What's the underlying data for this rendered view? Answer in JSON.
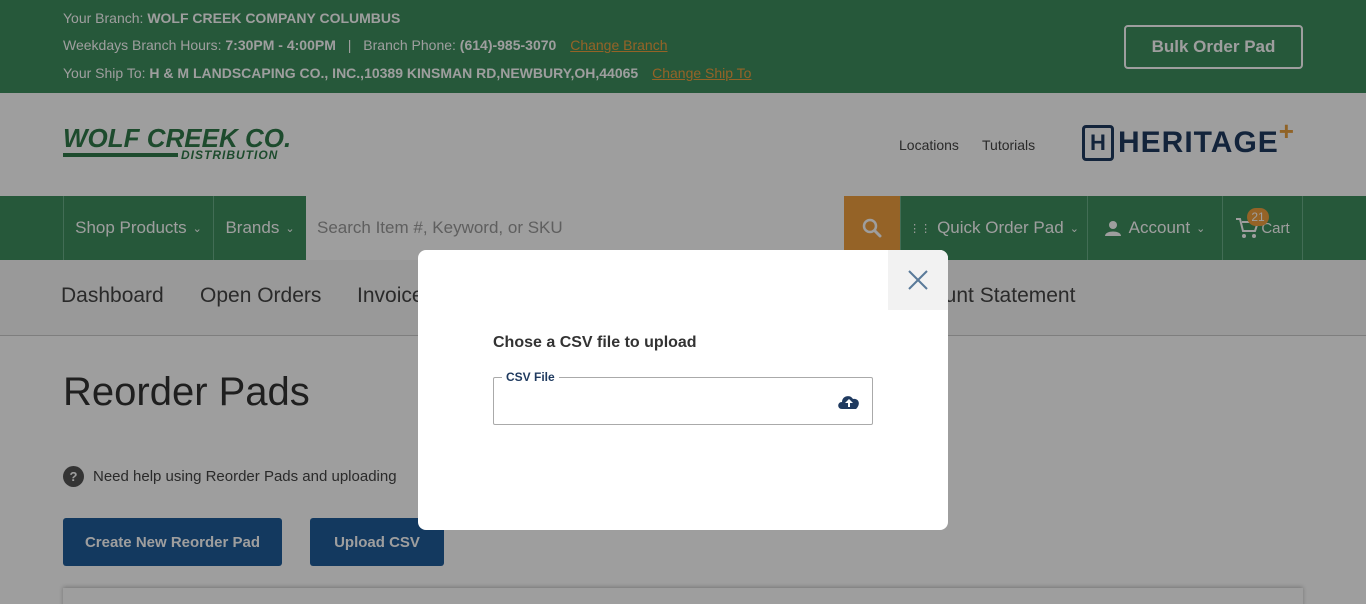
{
  "topbar": {
    "branch_label": "Your Branch:",
    "branch_value": "WOLF CREEK COMPANY COLUMBUS",
    "hours_label": "Weekdays Branch Hours:",
    "hours_value": "7:30PM - 4:00PM",
    "separator": "|",
    "phone_label": "Branch Phone:",
    "phone_value": "(614)-985-3070",
    "change_branch": "Change Branch",
    "shipto_label": "Your Ship To:",
    "shipto_value": "H & M LANDSCAPING CO., INC.,10389 KINSMAN RD,NEWBURY,OH,44065",
    "change_shipto": "Change Ship To",
    "bulk_order": "Bulk Order Pad"
  },
  "header": {
    "logo_main": "WOLF CREEK CO.",
    "logo_sub": "DISTRIBUTION",
    "locations": "Locations",
    "tutorials": "Tutorials",
    "partner_logo_letter": "H",
    "partner_logo": "HERITAGE",
    "partner_plus": "+"
  },
  "nav": {
    "shop_products": "Shop Products",
    "brands": "Brands",
    "search_placeholder": "Search Item #, Keyword, or SKU",
    "quick_order": "Quick Order Pad",
    "account": "Account",
    "cart": "Cart",
    "cart_count": "21"
  },
  "tabs": {
    "dashboard": "Dashboard",
    "open_orders": "Open Orders",
    "invoices": "Invoices",
    "account_statement": "Account Statement"
  },
  "content": {
    "title": "Reorder Pads",
    "help_text": "Need help using Reorder Pads and uploading",
    "create_button": "Create New Reorder Pad",
    "upload_button": "Upload CSV"
  },
  "modal": {
    "title": "Chose a CSV file to upload",
    "field_legend": "CSV File"
  },
  "colors": {
    "brand_green": "#3e8e5e",
    "accent_orange": "#f0a040",
    "button_blue": "#1f5c9a"
  }
}
